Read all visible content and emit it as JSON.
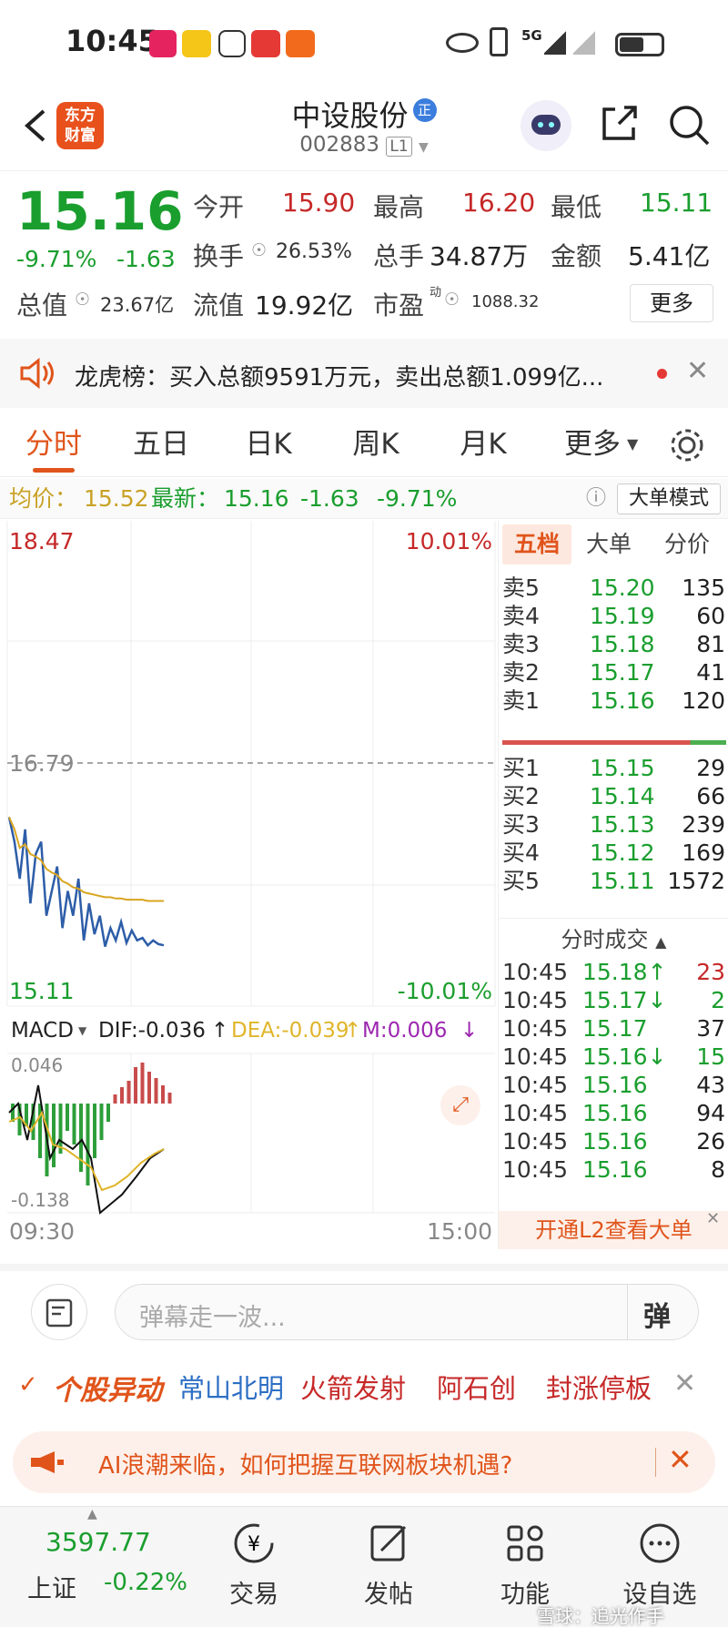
{
  "status_bar": {
    "time": "10:45",
    "network": "5G"
  },
  "header": {
    "back_icon": "chevron-left-icon",
    "app_logo_line1": "东方",
    "app_logo_line2": "财富",
    "stock_name": "中设股份",
    "stock_badge": "正",
    "stock_code": "002883",
    "level_badge": "L1"
  },
  "quote": {
    "price": "15.16",
    "change_pct": "-9.71%",
    "change": "-1.63",
    "open_label": "今开",
    "open": "15.90",
    "high_label": "最高",
    "high": "16.20",
    "low_label": "最低",
    "low": "15.11",
    "turnover_label": "换手",
    "turnover": "26.53%",
    "volume_label": "总手",
    "volume": "34.87万",
    "amount_label": "金额",
    "amount": "5.41亿",
    "mktcap_label": "总值",
    "mktcap": "23.67亿",
    "float_label": "流值",
    "float_cap": "19.92亿",
    "pe_label": "市盈",
    "pe_sup": "动",
    "pe": "1088.32",
    "more_button": "更多"
  },
  "notice": {
    "text": "龙虎榜：买入总额9591万元，卖出总额1.099亿..."
  },
  "tabs": [
    {
      "label": "分时",
      "active": true
    },
    {
      "label": "五日"
    },
    {
      "label": "日K"
    },
    {
      "label": "周K"
    },
    {
      "label": "月K"
    },
    {
      "label": "更多"
    }
  ],
  "price_bar": {
    "avg_label": "均价：",
    "avg": "15.52",
    "latest_label": "最新：",
    "latest": "15.16",
    "change": "-1.63",
    "change_pct": "-9.71%",
    "mode_button": "大单模式"
  },
  "chart": {
    "y_top": "18.47",
    "y_mid": "16.79",
    "y_bottom": "15.11",
    "pct_top": "10.01%",
    "pct_bottom": "-10.01%",
    "macd_label": "MACD",
    "dif": "DIF:-0.036",
    "dea": "DEA:-0.039",
    "m": "M:0.006",
    "macd_top": "0.046",
    "macd_bottom": "-0.138",
    "time_start": "09:30",
    "time_end": "15:00"
  },
  "chart_data": {
    "type": "line",
    "series": [
      {
        "values": [
          16.2,
          16.0,
          15.7,
          16.1,
          15.5,
          15.9,
          16.0,
          15.4,
          15.6,
          15.8,
          15.3,
          15.6,
          15.4,
          15.7,
          15.2,
          15.5,
          15.25,
          15.4,
          15.15,
          15.3,
          15.2,
          15.35,
          15.18,
          15.28,
          15.2,
          15.22,
          15.16,
          15.2,
          15.17,
          15.16
        ]
      },
      {
        "values": [
          16.2,
          16.1,
          15.95,
          15.98,
          15.9,
          15.88,
          15.85,
          15.78,
          15.75,
          15.73,
          15.68,
          15.66,
          15.63,
          15.62,
          15.59,
          15.58,
          15.57,
          15.56,
          15.55,
          15.55,
          15.54,
          15.54,
          15.53,
          15.53,
          15.53,
          15.53,
          15.52,
          15.52,
          15.52,
          15.52
        ]
      }
    ],
    "ylim": [
      15.11,
      18.47
    ]
  },
  "book": {
    "tabs": [
      "五档",
      "大单",
      "分价"
    ],
    "asks": [
      {
        "label": "卖5",
        "price": "15.20",
        "vol": "135"
      },
      {
        "label": "卖4",
        "price": "15.19",
        "vol": "60"
      },
      {
        "label": "卖3",
        "price": "15.18",
        "vol": "81"
      },
      {
        "label": "卖2",
        "price": "15.17",
        "vol": "41"
      },
      {
        "label": "卖1",
        "price": "15.16",
        "vol": "120"
      }
    ],
    "bids": [
      {
        "label": "买1",
        "price": "15.15",
        "vol": "29"
      },
      {
        "label": "买2",
        "price": "15.14",
        "vol": "66"
      },
      {
        "label": "买3",
        "price": "15.13",
        "vol": "239"
      },
      {
        "label": "买4",
        "price": "15.12",
        "vol": "169"
      },
      {
        "label": "买5",
        "price": "15.11",
        "vol": "1572"
      }
    ],
    "trades_title": "分时成交",
    "trades": [
      {
        "time": "10:45",
        "price": "15.18↑",
        "vol": "23"
      },
      {
        "time": "10:45",
        "price": "15.17↓",
        "vol": "2"
      },
      {
        "time": "10:45",
        "price": "15.17",
        "vol": "37"
      },
      {
        "time": "10:45",
        "price": "15.16↓",
        "vol": "15"
      },
      {
        "time": "10:45",
        "price": "15.16",
        "vol": "43"
      },
      {
        "time": "10:45",
        "price": "15.16",
        "vol": "94"
      },
      {
        "time": "10:45",
        "price": "15.16",
        "vol": "26"
      },
      {
        "time": "10:45",
        "price": "15.16",
        "vol": "8"
      }
    ],
    "l2_text": "开通L2查看大单"
  },
  "danmu": {
    "placeholder": "弹幕走一波...",
    "send_label": "弹"
  },
  "stock_alert": {
    "title": "个股异动",
    "items": [
      "常山北明",
      "火箭发射",
      "阿石创",
      "封涨停板"
    ]
  },
  "ai_bar": {
    "text": "AI浪潮来临，如何把握互联网板块机遇?"
  },
  "bottom_nav": {
    "index_value": "3597.77",
    "index_name": "上证",
    "index_change": "-0.22%",
    "items": [
      "交易",
      "发帖",
      "功能",
      "设自选"
    ]
  },
  "watermark": "雪球：追光作手",
  "colors": {
    "up": "#c62828",
    "down": "#1a9e2e",
    "accent": "#e0541b",
    "price_line": "#2d5da8",
    "avg_line": "#d9a520"
  }
}
